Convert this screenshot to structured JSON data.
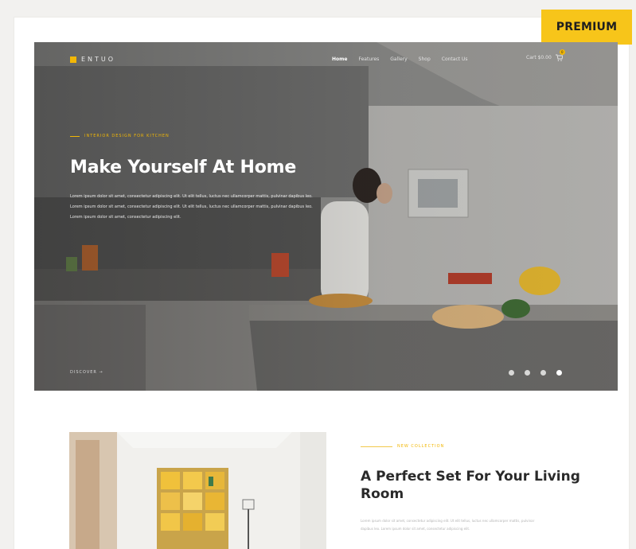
{
  "badge": {
    "label": "PREMIUM",
    "color": "#f7c51a"
  },
  "brand": {
    "name": "ENTUO",
    "accent": "#f2b705",
    "icon": "logo-square-icon"
  },
  "nav": {
    "items": [
      {
        "label": "Home",
        "active": true
      },
      {
        "label": "Features"
      },
      {
        "label": "Gallery"
      },
      {
        "label": "Shop"
      },
      {
        "label": "Contact Us"
      }
    ],
    "cart_label": "Cart $0.00",
    "cart_count": "0"
  },
  "hero": {
    "kicker": "INTERIOR DESIGN FOR KITCHEN",
    "title": "Make Yourself At Home",
    "description": "Lorem ipsum dolor sit amet, consectetur adipiscing elit. Ut elit tellus, luctus nec ullamcorper mattis, pulvinar dapibus leo. Lorem ipsum dolor sit amet, consectetur adipiscing elit. Ut elit tellus, luctus nec ullamcorper mattis, pulvinar dapibus leo. Lorem ipsum dolor sit amet, consectetur adipiscing elit.",
    "cta": "DISCOVER →",
    "slides": 4,
    "active_slide": 4
  },
  "section": {
    "kicker": "NEW COLLECTION",
    "title": "A Perfect Set For Your Living Room",
    "description": "Lorem ipsum dolor sit amet, consectetur adipiscing elit. Ut elit tellus, luctus nec ullamcorper mattis, pulvinar dapibus leo. Lorem ipsum dolor sit amet, consectetur adipiscing elit."
  }
}
